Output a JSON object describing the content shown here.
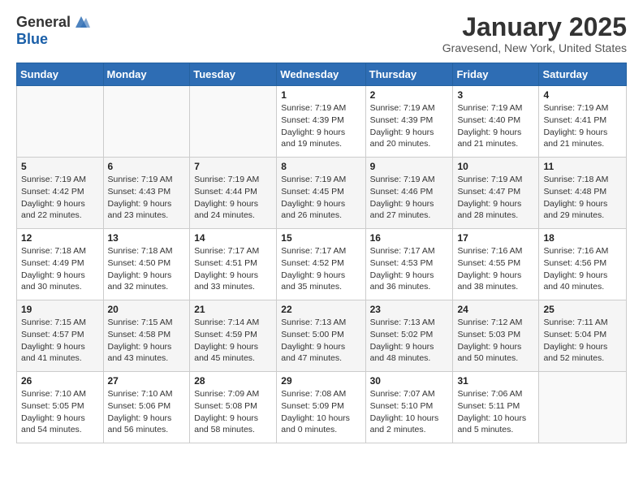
{
  "header": {
    "logo_general": "General",
    "logo_blue": "Blue",
    "month_title": "January 2025",
    "location": "Gravesend, New York, United States"
  },
  "weekdays": [
    "Sunday",
    "Monday",
    "Tuesday",
    "Wednesday",
    "Thursday",
    "Friday",
    "Saturday"
  ],
  "weeks": [
    [
      {
        "day": "",
        "info": ""
      },
      {
        "day": "",
        "info": ""
      },
      {
        "day": "",
        "info": ""
      },
      {
        "day": "1",
        "info": "Sunrise: 7:19 AM\nSunset: 4:39 PM\nDaylight: 9 hours\nand 19 minutes."
      },
      {
        "day": "2",
        "info": "Sunrise: 7:19 AM\nSunset: 4:39 PM\nDaylight: 9 hours\nand 20 minutes."
      },
      {
        "day": "3",
        "info": "Sunrise: 7:19 AM\nSunset: 4:40 PM\nDaylight: 9 hours\nand 21 minutes."
      },
      {
        "day": "4",
        "info": "Sunrise: 7:19 AM\nSunset: 4:41 PM\nDaylight: 9 hours\nand 21 minutes."
      }
    ],
    [
      {
        "day": "5",
        "info": "Sunrise: 7:19 AM\nSunset: 4:42 PM\nDaylight: 9 hours\nand 22 minutes."
      },
      {
        "day": "6",
        "info": "Sunrise: 7:19 AM\nSunset: 4:43 PM\nDaylight: 9 hours\nand 23 minutes."
      },
      {
        "day": "7",
        "info": "Sunrise: 7:19 AM\nSunset: 4:44 PM\nDaylight: 9 hours\nand 24 minutes."
      },
      {
        "day": "8",
        "info": "Sunrise: 7:19 AM\nSunset: 4:45 PM\nDaylight: 9 hours\nand 26 minutes."
      },
      {
        "day": "9",
        "info": "Sunrise: 7:19 AM\nSunset: 4:46 PM\nDaylight: 9 hours\nand 27 minutes."
      },
      {
        "day": "10",
        "info": "Sunrise: 7:19 AM\nSunset: 4:47 PM\nDaylight: 9 hours\nand 28 minutes."
      },
      {
        "day": "11",
        "info": "Sunrise: 7:18 AM\nSunset: 4:48 PM\nDaylight: 9 hours\nand 29 minutes."
      }
    ],
    [
      {
        "day": "12",
        "info": "Sunrise: 7:18 AM\nSunset: 4:49 PM\nDaylight: 9 hours\nand 30 minutes."
      },
      {
        "day": "13",
        "info": "Sunrise: 7:18 AM\nSunset: 4:50 PM\nDaylight: 9 hours\nand 32 minutes."
      },
      {
        "day": "14",
        "info": "Sunrise: 7:17 AM\nSunset: 4:51 PM\nDaylight: 9 hours\nand 33 minutes."
      },
      {
        "day": "15",
        "info": "Sunrise: 7:17 AM\nSunset: 4:52 PM\nDaylight: 9 hours\nand 35 minutes."
      },
      {
        "day": "16",
        "info": "Sunrise: 7:17 AM\nSunset: 4:53 PM\nDaylight: 9 hours\nand 36 minutes."
      },
      {
        "day": "17",
        "info": "Sunrise: 7:16 AM\nSunset: 4:55 PM\nDaylight: 9 hours\nand 38 minutes."
      },
      {
        "day": "18",
        "info": "Sunrise: 7:16 AM\nSunset: 4:56 PM\nDaylight: 9 hours\nand 40 minutes."
      }
    ],
    [
      {
        "day": "19",
        "info": "Sunrise: 7:15 AM\nSunset: 4:57 PM\nDaylight: 9 hours\nand 41 minutes."
      },
      {
        "day": "20",
        "info": "Sunrise: 7:15 AM\nSunset: 4:58 PM\nDaylight: 9 hours\nand 43 minutes."
      },
      {
        "day": "21",
        "info": "Sunrise: 7:14 AM\nSunset: 4:59 PM\nDaylight: 9 hours\nand 45 minutes."
      },
      {
        "day": "22",
        "info": "Sunrise: 7:13 AM\nSunset: 5:00 PM\nDaylight: 9 hours\nand 47 minutes."
      },
      {
        "day": "23",
        "info": "Sunrise: 7:13 AM\nSunset: 5:02 PM\nDaylight: 9 hours\nand 48 minutes."
      },
      {
        "day": "24",
        "info": "Sunrise: 7:12 AM\nSunset: 5:03 PM\nDaylight: 9 hours\nand 50 minutes."
      },
      {
        "day": "25",
        "info": "Sunrise: 7:11 AM\nSunset: 5:04 PM\nDaylight: 9 hours\nand 52 minutes."
      }
    ],
    [
      {
        "day": "26",
        "info": "Sunrise: 7:10 AM\nSunset: 5:05 PM\nDaylight: 9 hours\nand 54 minutes."
      },
      {
        "day": "27",
        "info": "Sunrise: 7:10 AM\nSunset: 5:06 PM\nDaylight: 9 hours\nand 56 minutes."
      },
      {
        "day": "28",
        "info": "Sunrise: 7:09 AM\nSunset: 5:08 PM\nDaylight: 9 hours\nand 58 minutes."
      },
      {
        "day": "29",
        "info": "Sunrise: 7:08 AM\nSunset: 5:09 PM\nDaylight: 10 hours\nand 0 minutes."
      },
      {
        "day": "30",
        "info": "Sunrise: 7:07 AM\nSunset: 5:10 PM\nDaylight: 10 hours\nand 2 minutes."
      },
      {
        "day": "31",
        "info": "Sunrise: 7:06 AM\nSunset: 5:11 PM\nDaylight: 10 hours\nand 5 minutes."
      },
      {
        "day": "",
        "info": ""
      }
    ]
  ]
}
